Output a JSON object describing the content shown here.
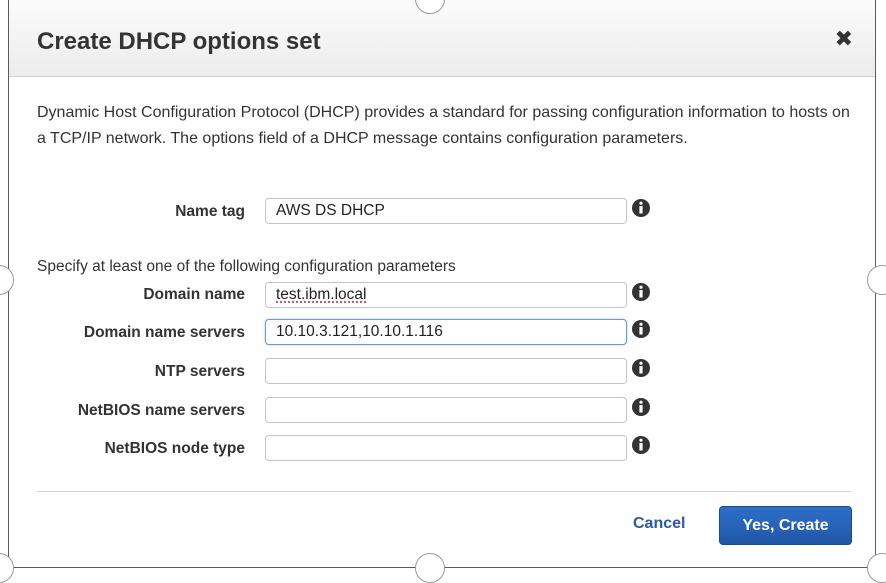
{
  "dialog": {
    "title": "Create DHCP options set",
    "close_icon": "close-icon",
    "description": "Dynamic Host Configuration Protocol (DHCP) provides a standard for passing configuration information to hosts on a TCP/IP network. The options field of a DHCP message contains configuration parameters."
  },
  "form": {
    "name_tag": {
      "label": "Name tag",
      "value": "AWS DS DHCP"
    },
    "hint": "Specify at least one of the following configuration parameters",
    "domain_name": {
      "label": "Domain name",
      "value": "test.ibm.local"
    },
    "domain_name_servers": {
      "label": "Domain name servers",
      "value": "10.10.3.121,10.10.1.116"
    },
    "ntp_servers": {
      "label": "NTP servers",
      "value": ""
    },
    "netbios_name_servers": {
      "label": "NetBIOS name servers",
      "value": ""
    },
    "netbios_node_type": {
      "label": "NetBIOS node type",
      "value": ""
    }
  },
  "footer": {
    "cancel_label": "Cancel",
    "create_label": "Yes, Create"
  },
  "colors": {
    "primary": "#2566b8",
    "link": "#2a5aa6"
  }
}
